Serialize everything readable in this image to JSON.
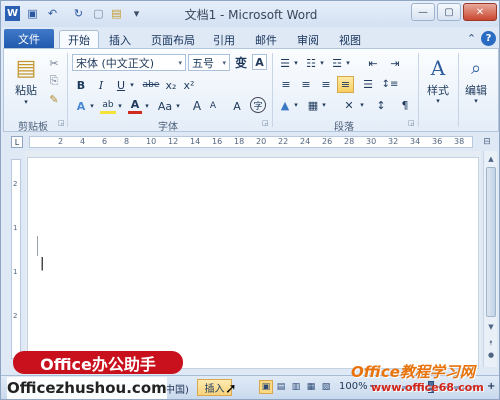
{
  "titlebar": {
    "title": "文档1 - Microsoft Word",
    "qat": [
      {
        "icon": "word-app-icon",
        "glyph": "W"
      },
      {
        "icon": "save-icon",
        "glyph": "▣"
      },
      {
        "icon": "undo-icon",
        "glyph": "↶"
      },
      {
        "icon": "redo-icon",
        "glyph": "↻"
      },
      {
        "icon": "new-document-icon",
        "glyph": "▢"
      },
      {
        "icon": "open-folder-icon",
        "glyph": "▤"
      },
      {
        "icon": "customize-qat-icon",
        "glyph": "▾"
      }
    ],
    "window_buttons": {
      "minimize": "—",
      "maximize": "▢",
      "close": "✕"
    }
  },
  "tabs": {
    "file": "文件",
    "items": [
      "开始",
      "插入",
      "页面布局",
      "引用",
      "邮件",
      "审阅",
      "视图"
    ],
    "active": "开始",
    "right_icons": {
      "minimize_ribbon": "⌃",
      "help": "?"
    }
  },
  "ribbon": {
    "clipboard": {
      "label": "剪贴板",
      "paste": "粘贴",
      "cut_icon": "✂",
      "copy_icon": "⎘",
      "format_painter_icon": "✎"
    },
    "font": {
      "label": "字体",
      "font_name": "宋体 (中文正文)",
      "font_size": "五号",
      "buttons_row1": [
        "B",
        "I",
        "U",
        "abe",
        "x₂",
        "x²"
      ],
      "grow_font": "A",
      "shrink_font": "A",
      "change_case": "Aa",
      "clear_format": "A",
      "phonetic": "文",
      "char_border": "A",
      "buttons_row2": [
        "A",
        "ab",
        "A",
        "Aa",
        "A",
        "A",
        "A",
        "字"
      ]
    },
    "paragraph": {
      "label": "段落",
      "row1": [
        "☰",
        "☷",
        "☲",
        "⇤",
        "⇥"
      ],
      "row2": [
        "≡",
        "≡",
        "≡",
        "≡",
        "☰"
      ],
      "row3": [
        "▲",
        "▦",
        "✕",
        "↕",
        "¶"
      ]
    },
    "styles": {
      "label": "样式",
      "icon": "A"
    },
    "editing": {
      "label": "编辑",
      "icon": "⌕"
    }
  },
  "ruler": {
    "corner": "L",
    "numbers": [
      "2",
      "4",
      "6",
      "8",
      "10",
      "12",
      "14",
      "16",
      "18",
      "20",
      "22",
      "24",
      "26",
      "28",
      "30",
      "32",
      "34",
      "36",
      "38"
    ],
    "right_icon": "⊟"
  },
  "vruler": {
    "numbers": [
      "2",
      "1",
      "1",
      "2"
    ]
  },
  "document": {
    "cursor": "|"
  },
  "statusbar": {
    "language": "中国)",
    "insert_mode": "插入",
    "zoom": "100%",
    "zoom_minus": "−",
    "zoom_plus": "+",
    "views": [
      "▣",
      "▤",
      "▥",
      "▦",
      "▧"
    ]
  },
  "watermarks": {
    "brand_badge": "Office办公助手",
    "brand_url": "Officezhushou.com",
    "site_name_cn": "Office教程学习网",
    "site_url": "www.office68.com"
  },
  "colors": {
    "file_tab": "#2a63b8",
    "brand_red": "#c9101d",
    "highlight": "#f8cf61"
  }
}
